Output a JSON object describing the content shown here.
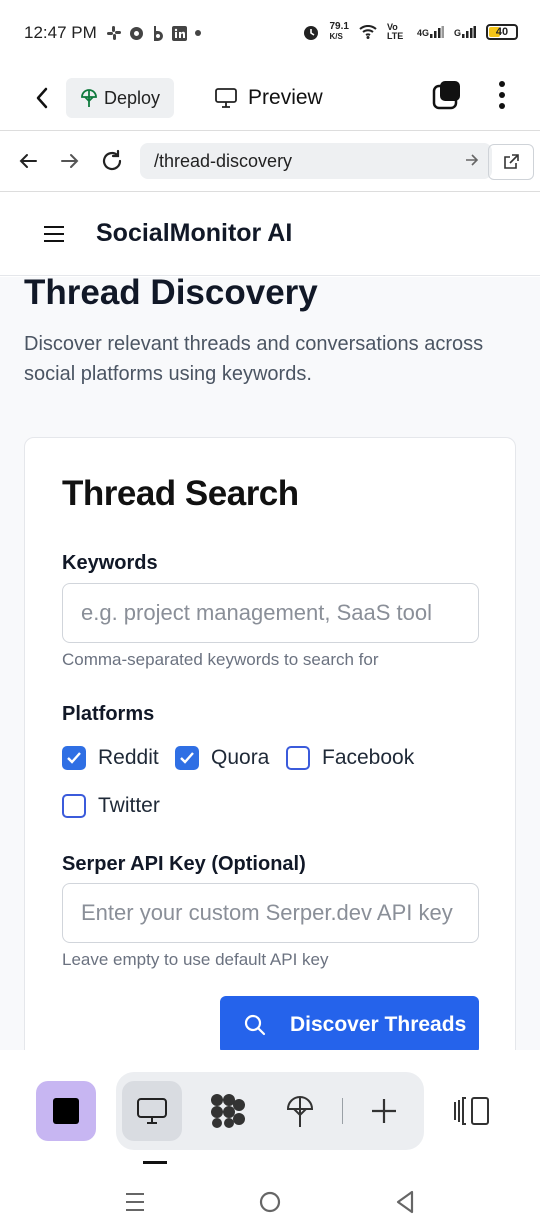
{
  "status_bar": {
    "time": "12:47 PM",
    "net_speed": "79.1",
    "net_unit": "K/S",
    "volte": "Vo LTE",
    "network_4g": "4G",
    "network_g": "G",
    "battery": "40"
  },
  "app_header": {
    "deploy_label": "Deploy",
    "preview_label": "Preview"
  },
  "url_bar": {
    "url": "/thread-discovery"
  },
  "site_nav": {
    "brand": "SocialMonitor AI"
  },
  "page": {
    "title": "Thread Discovery",
    "description": "Discover relevant threads and conversations across social platforms using keywords."
  },
  "card": {
    "title": "Thread Search",
    "keywords": {
      "label": "Keywords",
      "placeholder": "e.g. project management, SaaS tool",
      "hint": "Comma-separated keywords to search for"
    },
    "platforms": {
      "label": "Platforms",
      "options": [
        {
          "label": "Reddit",
          "checked": true
        },
        {
          "label": "Quora",
          "checked": true
        },
        {
          "label": "Facebook",
          "checked": false
        },
        {
          "label": "Twitter",
          "checked": false
        }
      ]
    },
    "api_key": {
      "label": "Serper API Key (Optional)",
      "placeholder": "Enter your custom Serper.dev API key",
      "hint": "Leave empty to use default API key"
    },
    "submit_label": "Discover Threads"
  },
  "colors": {
    "accent": "#2563eb",
    "active_tab": "#c7b6f2"
  }
}
